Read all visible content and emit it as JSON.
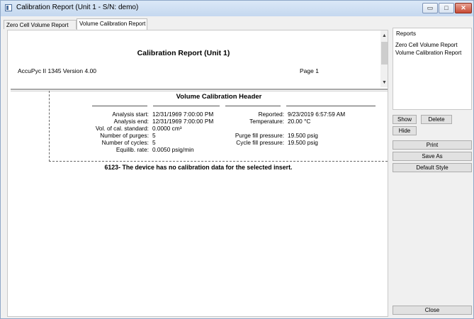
{
  "window": {
    "title": "Calibration Report (Unit 1 - S/N: demo)",
    "controls": {
      "minimize": "▭",
      "maximize": "□",
      "close": "✕"
    }
  },
  "tabs": [
    {
      "label": "Zero Cell Volume Report"
    },
    {
      "label": "Volume Calibration Report"
    }
  ],
  "report": {
    "title": "Calibration Report (Unit 1)",
    "instrument": "AccuPyc II 1345 Version 4.00",
    "page": "Page 1",
    "section_title": "Volume Calibration Header",
    "fields_left": [
      {
        "label": "Analysis start:",
        "value": "12/31/1969 7:00:00 PM"
      },
      {
        "label": "Analysis end:",
        "value": "12/31/1969 7:00:00 PM"
      },
      {
        "label": "Vol. of cal. standard:",
        "value": "0.0000 cm³"
      },
      {
        "label": "Number of purges:",
        "value": "5"
      },
      {
        "label": "Number of cycles:",
        "value": "5"
      },
      {
        "label": "Equilib. rate:",
        "value": "0.0050 psig/min"
      }
    ],
    "fields_right": [
      {
        "label": "Reported:",
        "value": "9/23/2019 6:57:59 AM"
      },
      {
        "label": "Temperature:",
        "value": "20.00 °C"
      },
      {
        "label": "Purge fill pressure:",
        "value": "19.500 psig"
      },
      {
        "label": "Cycle fill pressure:",
        "value": "19.500 psig"
      }
    ],
    "message": "6123-  The device has no calibration data for the selected insert."
  },
  "sidebar": {
    "reports_header": "Reports",
    "reports": [
      "Zero Cell Volume Report",
      "Volume Calibration Report"
    ],
    "buttons": {
      "show": "Show",
      "delete": "Delete",
      "hide": "Hide",
      "print": "Print",
      "save_as": "Save As",
      "default_style": "Default Style",
      "close": "Close"
    }
  }
}
